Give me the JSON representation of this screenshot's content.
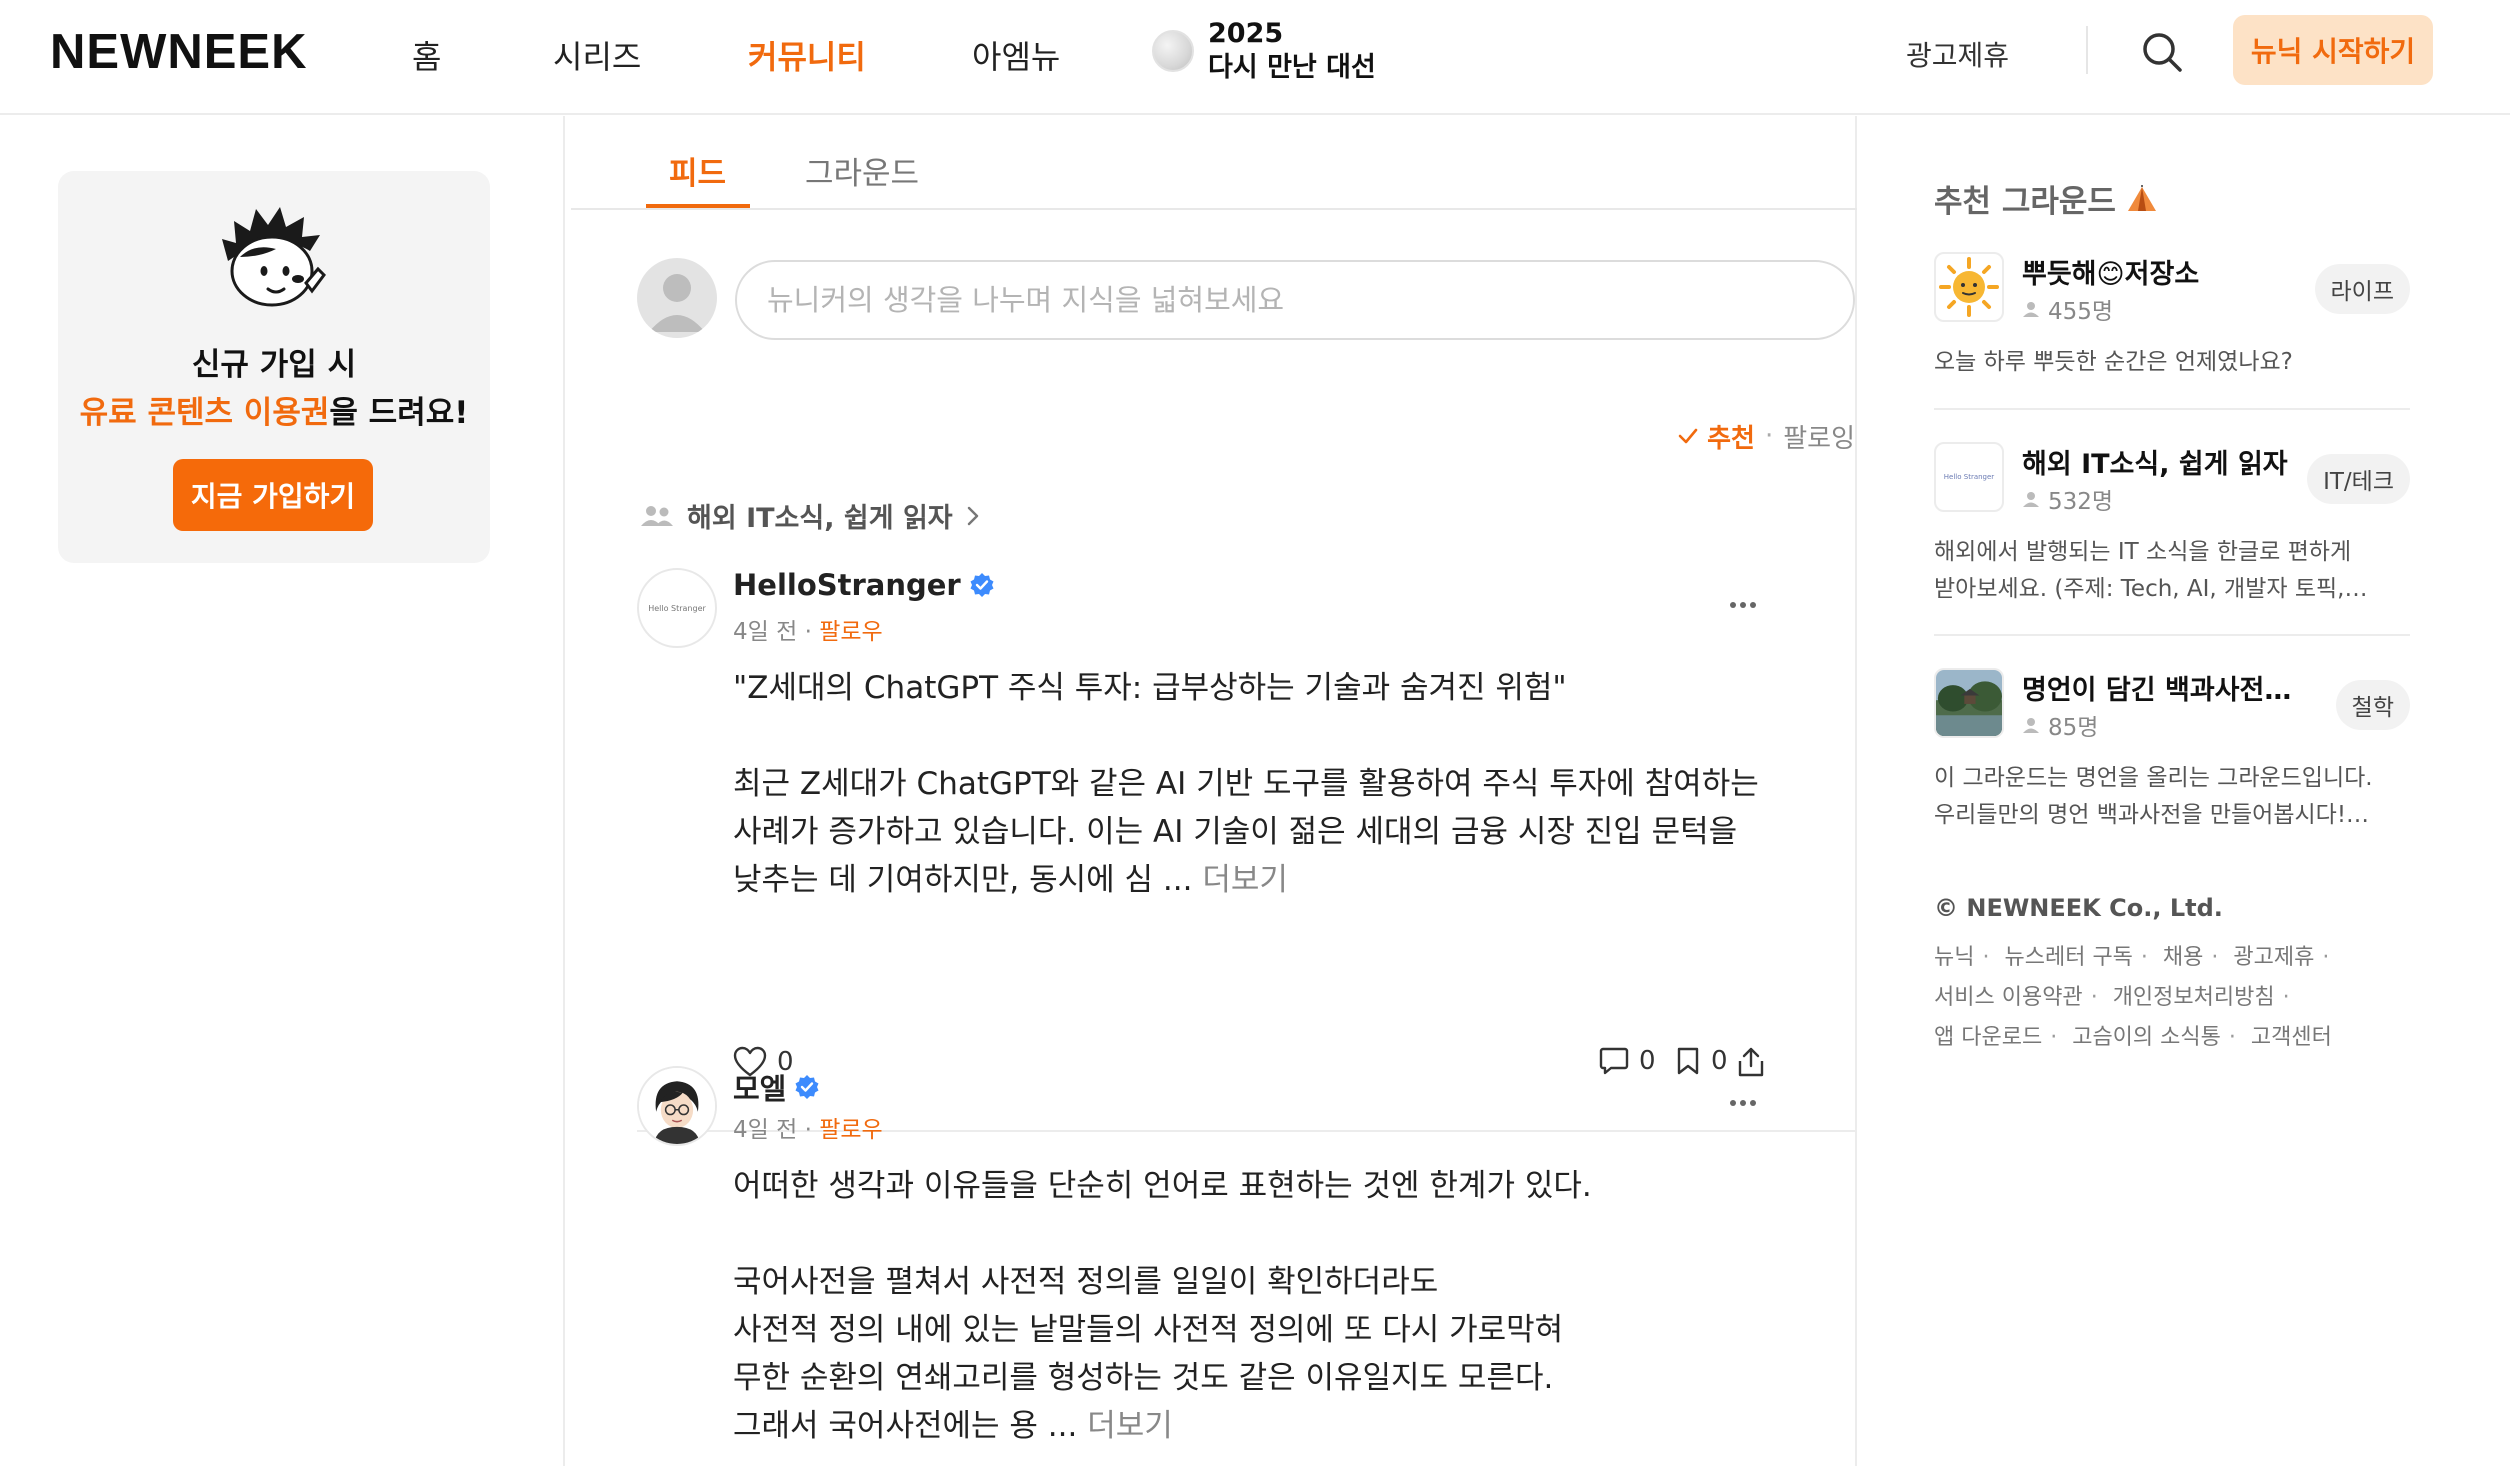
{
  "header": {
    "logo": "NEWNEEK",
    "nav": [
      {
        "label": "홈"
      },
      {
        "label": "시리즈"
      },
      {
        "label": "커뮤니티"
      },
      {
        "label": "아엠뉴"
      }
    ],
    "election": {
      "line1": "2025",
      "line2": "다시 만난 대선"
    },
    "ad_link": "광고제휴",
    "start_button": "뉴닉 시작하기"
  },
  "promo": {
    "line1": "신규 가입 시",
    "highlight": "유료 콘텐츠 이용권",
    "line2_suffix": "을 드려요!",
    "button": "지금 가입하기"
  },
  "feed": {
    "tabs": [
      {
        "label": "피드"
      },
      {
        "label": "그라운드"
      }
    ],
    "composer_placeholder": "뉴니커의 생각을 나누며 지식을 넓혀보세요",
    "sort": {
      "active": "추천",
      "other": "팔로잉"
    },
    "ground_link": "해외 IT소식, 쉽게 읽자",
    "posts": [
      {
        "author": "HelloStranger",
        "avatar_text": "Hello Stranger",
        "time": "4일 전",
        "follow": "팔로우",
        "body": "\"Z세대의 ChatGPT 주식 투자: 급부상하는 기술과 숨겨진 위험\"\n\n최근 Z세대가 ChatGPT와 같은 AI 기반 도구를 활용하여 주식 투자에 참여하는 사례가 증가하고 있습니다. 이는 AI 기술이 젊은 세대의 금융 시장 진입 문턱을 낮추는 데 기여하지만, 동시에 심 ... ",
        "more": "더보기",
        "likes": "0",
        "comments": "0",
        "bookmarks": "0"
      },
      {
        "author": "모엘",
        "time": "4일 전",
        "follow": "팔로우",
        "body": "어떠한 생각과 이유들을 단순히 언어로 표현하는 것엔 한계가 있다.\n\n국어사전을 펼쳐서 사전적 정의를 일일이 확인하더라도\n사전적 정의 내에 있는 낱말들의 사전적 정의에 또 다시 가로막혀\n무한 순환의 연쇄고리를 형성하는 것도 같은 이유일지도 모른다.\n그래서 국어사전에는 용 ... ",
        "more": "더보기"
      }
    ]
  },
  "recommend": {
    "title": "추천 그라운드",
    "items": [
      {
        "name": "뿌듯해😊저장소",
        "count": "455명",
        "tag": "라이프",
        "desc": "오늘 하루 뿌듯한 순간은 언제였나요?"
      },
      {
        "name": "해외 IT소식, 쉽게 읽자",
        "count": "532명",
        "tag": "IT/테크",
        "thumb_text": "Hello Stranger",
        "desc": "해외에서 발행되는 IT 소식을 한글로 편하게 받아보세요. (주제: Tech, AI, 개발자 토픽, 스타트업 등)"
      },
      {
        "name": "명언이 담긴 백과사전…",
        "count": "85명",
        "tag": "철학",
        "desc": "이 그라운드는 명언을 올리는 그라운드입니다. 우리들만의 명언 백과사전을 만들어봅시다! *…"
      }
    ]
  },
  "footer": {
    "copyright": "© NEWNEEK Co., Ltd.",
    "links": [
      "뉴닉",
      "뉴스레터 구독",
      "채용",
      "광고제휴",
      "서비스 이용약관",
      "개인정보처리방침",
      "앱 다운로드",
      "고슴이의 소식통",
      "고객센터"
    ]
  },
  "colors": {
    "accent": "#f16a0e",
    "accent_soft": "#fde2c6",
    "verified": "#3d8bfd"
  },
  "icons": [
    "search-icon",
    "check-icon",
    "people-icon",
    "chevron-right-icon",
    "verified-icon",
    "more-icon",
    "heart-icon",
    "comment-icon",
    "bookmark-icon",
    "share-icon",
    "tent-icon",
    "person-icon"
  ]
}
